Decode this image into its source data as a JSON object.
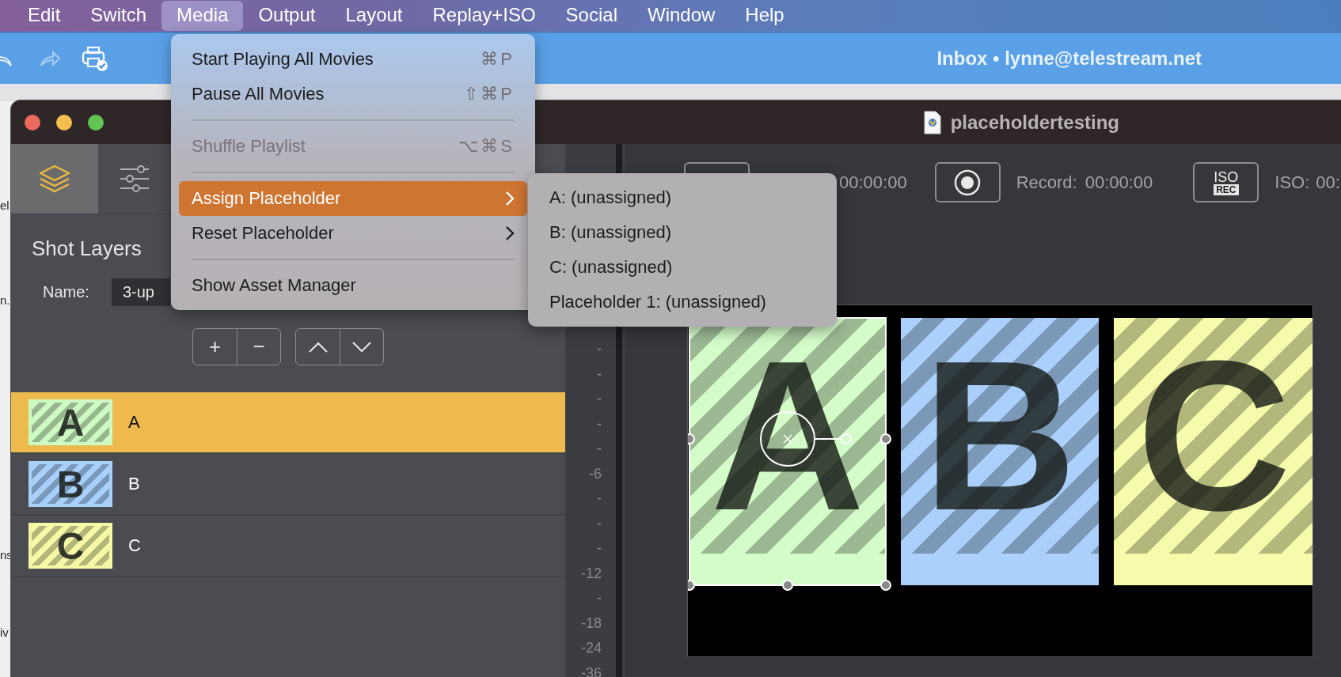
{
  "menubar": [
    {
      "label": "Edit",
      "selected": false
    },
    {
      "label": "Switch",
      "selected": false
    },
    {
      "label": "Media",
      "selected": true
    },
    {
      "label": "Output",
      "selected": false
    },
    {
      "label": "Layout",
      "selected": false
    },
    {
      "label": "Replay+ISO",
      "selected": false
    },
    {
      "label": "Social",
      "selected": false
    },
    {
      "label": "Window",
      "selected": false
    },
    {
      "label": "Help",
      "selected": false
    }
  ],
  "mail_window": {
    "title": "Inbox • lynne@telestream.net"
  },
  "background_window": {
    "texts": [
      "el",
      "n.",
      "ns",
      "iv"
    ]
  },
  "app_window": {
    "title": "placeholdertesting",
    "sidebar_tabs": [
      {
        "kind": "layers",
        "selected": true
      },
      {
        "kind": "sliders",
        "selected": false
      }
    ],
    "panel_title": "Shot Layers",
    "name_label": "Name:",
    "name_value": "3-up",
    "layer_buttons": [
      "+",
      "−"
    ],
    "layers": [
      {
        "thumb": "A",
        "label": "A",
        "color": "#cdf9c3",
        "selected": true
      },
      {
        "thumb": "B",
        "label": "B",
        "color": "#a7d0fb",
        "selected": false
      },
      {
        "thumb": "C",
        "label": "C",
        "color": "#f5f9a6",
        "selected": false
      }
    ],
    "meter_ticks": [
      "-",
      "-",
      "-",
      "-",
      "-",
      "-6",
      "-",
      "-",
      "-",
      "-12",
      "-",
      "-18",
      "-24",
      "-36"
    ],
    "toolbar": {
      "stream_time": "00:00:00",
      "record_label": "Record:",
      "record_time": "00:00:00",
      "iso_top": "ISO",
      "iso_bottom": "REC",
      "iso_label": "ISO:",
      "iso_time": "00:"
    },
    "preview_tiles": [
      {
        "letter": "A",
        "color": "#d4fcc9",
        "selected": true
      },
      {
        "letter": "B",
        "color": "#aad0fb",
        "selected": false
      },
      {
        "letter": "C",
        "color": "#f5fbaa",
        "selected": false
      }
    ]
  },
  "menu": {
    "items": [
      {
        "kind": "item",
        "label": "Start Playing All Movies",
        "shortcut": "⌘P",
        "disabled": false,
        "selected": false
      },
      {
        "kind": "item",
        "label": "Pause All Movies",
        "shortcut": "⇧⌘P",
        "disabled": false,
        "selected": false
      },
      {
        "kind": "separator"
      },
      {
        "kind": "item",
        "label": "Shuffle Playlist",
        "shortcut": "⌥⌘S",
        "disabled": true,
        "selected": false
      },
      {
        "kind": "separator"
      },
      {
        "kind": "submenu",
        "label": "Assign Placeholder",
        "disabled": false,
        "selected": true
      },
      {
        "kind": "submenu",
        "label": "Reset Placeholder",
        "disabled": false,
        "selected": false
      },
      {
        "kind": "separator"
      },
      {
        "kind": "item",
        "label": "Show Asset Manager",
        "disabled": false,
        "selected": false
      }
    ]
  },
  "submenu": {
    "items": [
      {
        "label": "A: (unassigned)",
        "selected": false
      },
      {
        "label": "B: (unassigned)",
        "selected": false
      },
      {
        "label": "C: (unassigned)",
        "selected": false
      },
      {
        "label": "Placeholder 1: (unassigned)",
        "selected": false
      }
    ]
  }
}
